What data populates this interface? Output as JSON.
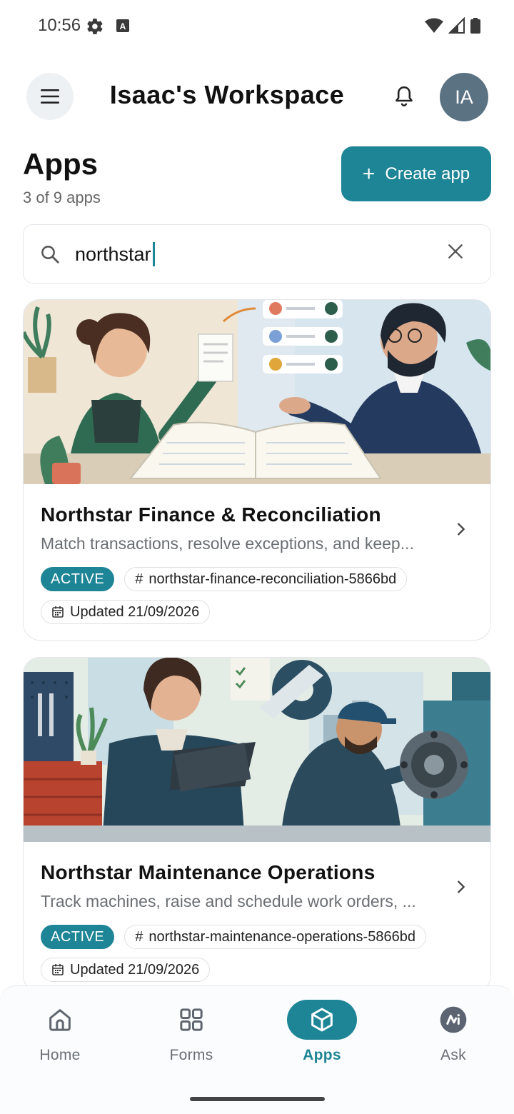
{
  "status_bar": {
    "time": "10:56"
  },
  "header": {
    "title": "Isaac's Workspace",
    "avatar_initials": "IA"
  },
  "apps": {
    "title": "Apps",
    "count_text": "3 of 9 apps",
    "create_label": "Create app"
  },
  "search": {
    "value": "northstar"
  },
  "cards": [
    {
      "title": "Northstar Finance & Reconciliation",
      "description": "Match transactions, resolve exceptions, and keep...",
      "status": "ACTIVE",
      "slug": "northstar-finance-reconciliation-5866bd",
      "updated": "Updated 21/09/2026"
    },
    {
      "title": "Northstar Maintenance Operations",
      "description": "Track machines, raise and schedule work orders, ...",
      "status": "ACTIVE",
      "slug": "northstar-maintenance-operations-5866bd",
      "updated": "Updated 21/09/2026"
    }
  ],
  "nav": {
    "items": [
      {
        "label": "Home",
        "icon": "home-icon"
      },
      {
        "label": "Forms",
        "icon": "grid-icon"
      },
      {
        "label": "Apps",
        "icon": "cube-icon",
        "active": true
      },
      {
        "label": "Ask",
        "icon": "ai-icon"
      }
    ]
  },
  "colors": {
    "accent": "#1e8596",
    "avatar": "#5b7282"
  }
}
